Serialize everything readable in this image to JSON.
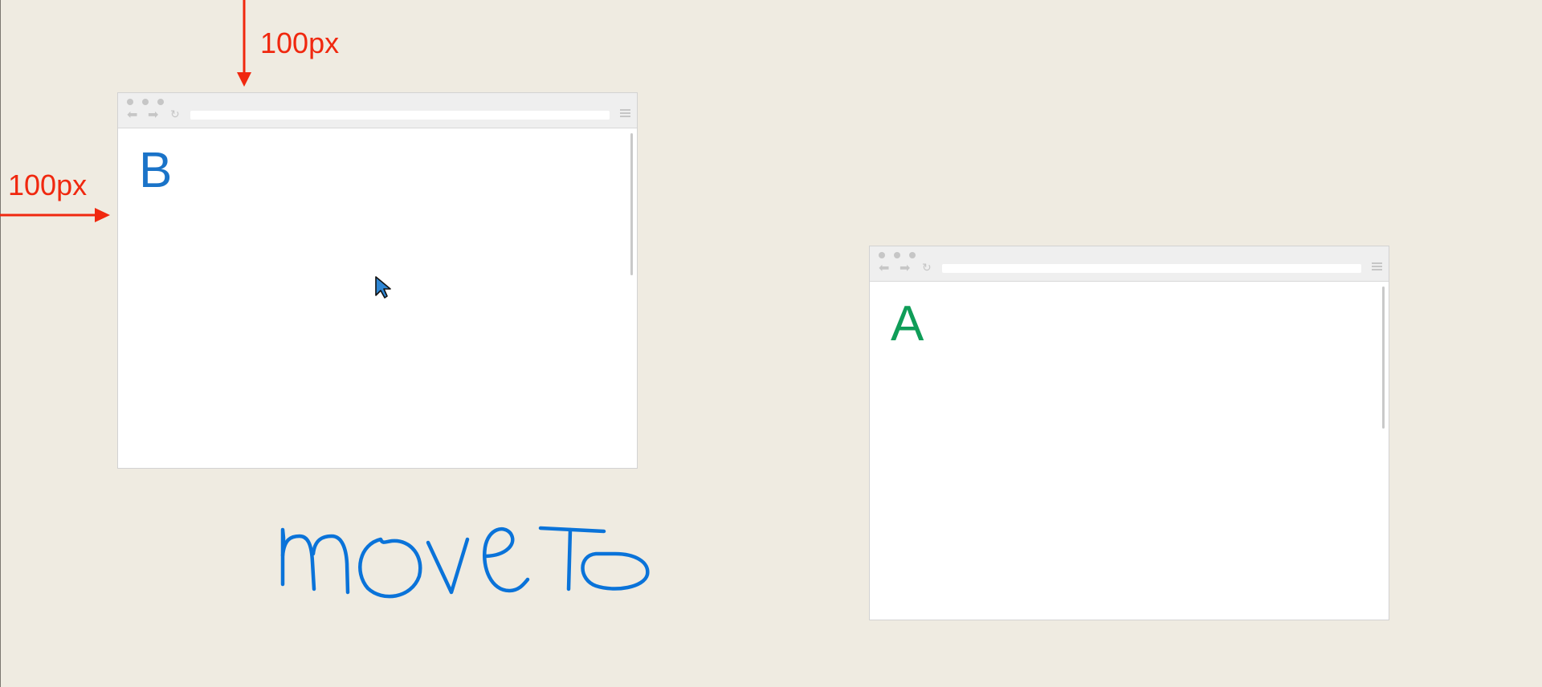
{
  "annotations": {
    "top_offset": "100px",
    "left_offset": "100px",
    "handwriting": "moveTo",
    "arrow_color": "#f0280f",
    "ink_color": "#0a73d9"
  },
  "window_b": {
    "letter": "B",
    "letter_color": "#1a73c8"
  },
  "window_a": {
    "letter": "A",
    "letter_color": "#0f9d58"
  },
  "icons": {
    "window_dots": "window-control-dots",
    "back": "back-arrow-icon",
    "forward": "forward-arrow-icon",
    "reload": "reload-icon",
    "menu": "hamburger-menu-icon",
    "pointer": "mouse-cursor-icon"
  },
  "background_color": "#efebe1"
}
